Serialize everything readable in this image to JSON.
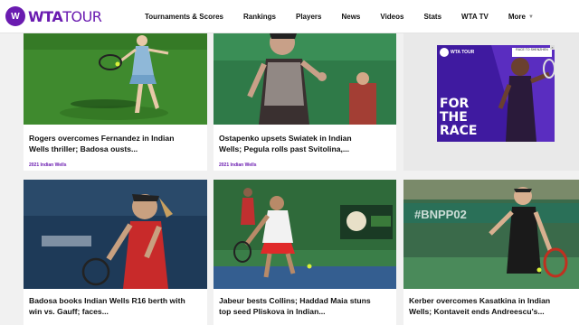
{
  "header": {
    "logo": {
      "mark": "W",
      "brand_bold": "WTA",
      "brand_light": "TOUR"
    },
    "nav": [
      {
        "label": "Tournaments & Scores"
      },
      {
        "label": "Rankings"
      },
      {
        "label": "Players"
      },
      {
        "label": "News"
      },
      {
        "label": "Videos"
      },
      {
        "label": "Stats"
      },
      {
        "label": "WTA TV"
      }
    ],
    "more_label": "More"
  },
  "cards": [
    {
      "title_line1": "Rogers overcomes Fernandez in Indian",
      "title_line2": "Wells thriller; Badosa ousts...",
      "tag": "2021 Indian Wells"
    },
    {
      "title_line1": "Ostapenko upsets Swiatek in Indian",
      "title_line2": "Wells; Pegula rolls past Svitolina,...",
      "tag": "2021 Indian Wells"
    },
    {
      "title_line1": "Badosa books Indian Wells R16 berth with",
      "title_line2": "win vs. Gauff; faces...",
      "tag": ""
    },
    {
      "title_line1": "Jabeur bests Collins; Haddad Maia stuns",
      "title_line2": "top seed Pliskova in Indian...",
      "tag": ""
    },
    {
      "title_line1": "Kerber overcomes Kasatkina in Indian",
      "title_line2": "Wells; Kontaveit ends Andreescu's...",
      "tag": ""
    }
  ],
  "ad": {
    "logo_text": "WTA TOUR",
    "banner_text": "RACE TO SHENZHEN",
    "headline_1": "FOR",
    "headline_2": "THE",
    "headline_3": "RACE",
    "close_glyph": "×"
  },
  "colors": {
    "brand": "#6a1bb0",
    "ad_bg": "#3f1aa0"
  }
}
